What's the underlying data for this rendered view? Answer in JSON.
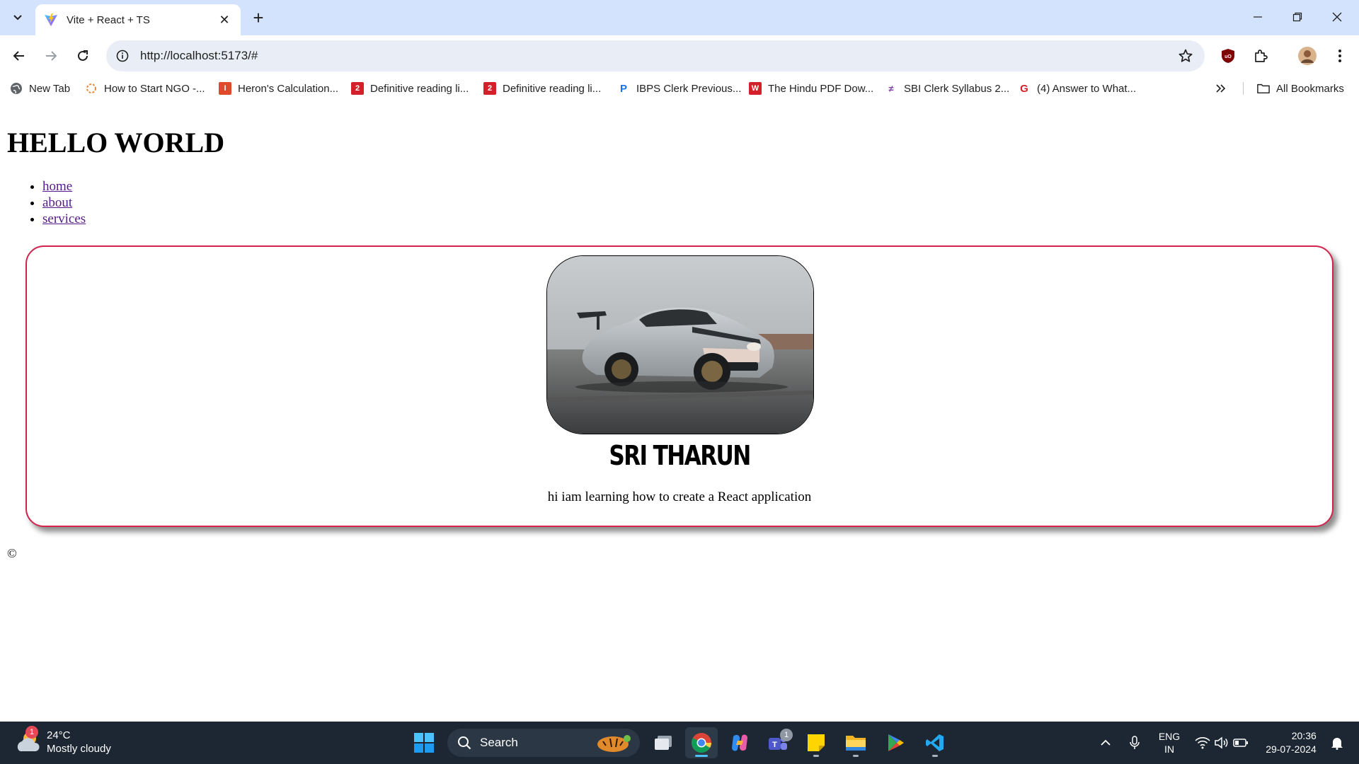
{
  "browser": {
    "tab": {
      "title": "Vite + React + TS"
    },
    "url": "http://localhost:5173/#",
    "bookmarks": [
      {
        "label": "New Tab",
        "icon": "globe-icon"
      },
      {
        "label": "How to Start NGO -...",
        "icon": "ngo-icon"
      },
      {
        "label": "Heron's Calculation...",
        "icon": "heron-icon"
      },
      {
        "label": "Definitive reading li...",
        "icon": "reading-icon"
      },
      {
        "label": "Definitive reading li...",
        "icon": "reading-icon"
      },
      {
        "label": "IBPS Clerk Previous...",
        "icon": "ibps-icon"
      },
      {
        "label": "The Hindu PDF Dow...",
        "icon": "hindu-icon"
      },
      {
        "label": "SBI Clerk Syllabus 2...",
        "icon": "sbi-icon"
      },
      {
        "label": "(4) Answer to What...",
        "icon": "quora-icon"
      }
    ],
    "all_bookmarks_label": "All Bookmarks"
  },
  "page": {
    "heading": "HELLO WORLD",
    "nav": [
      {
        "label": "home"
      },
      {
        "label": "about"
      },
      {
        "label": "services"
      }
    ],
    "card": {
      "image": "sports-car-photo",
      "name": "SRI THARUN",
      "text": "hi iam learning how to create a React application",
      "border_color": "#d4234b"
    },
    "footer": "©"
  },
  "taskbar": {
    "weather": {
      "temp": "24°C",
      "condition": "Mostly cloudy",
      "badge": "1"
    },
    "search_label": "Search",
    "teams_badge": "1",
    "lang_line1": "ENG",
    "lang_line2": "IN",
    "time": "20:36",
    "date": "29-07-2024"
  }
}
